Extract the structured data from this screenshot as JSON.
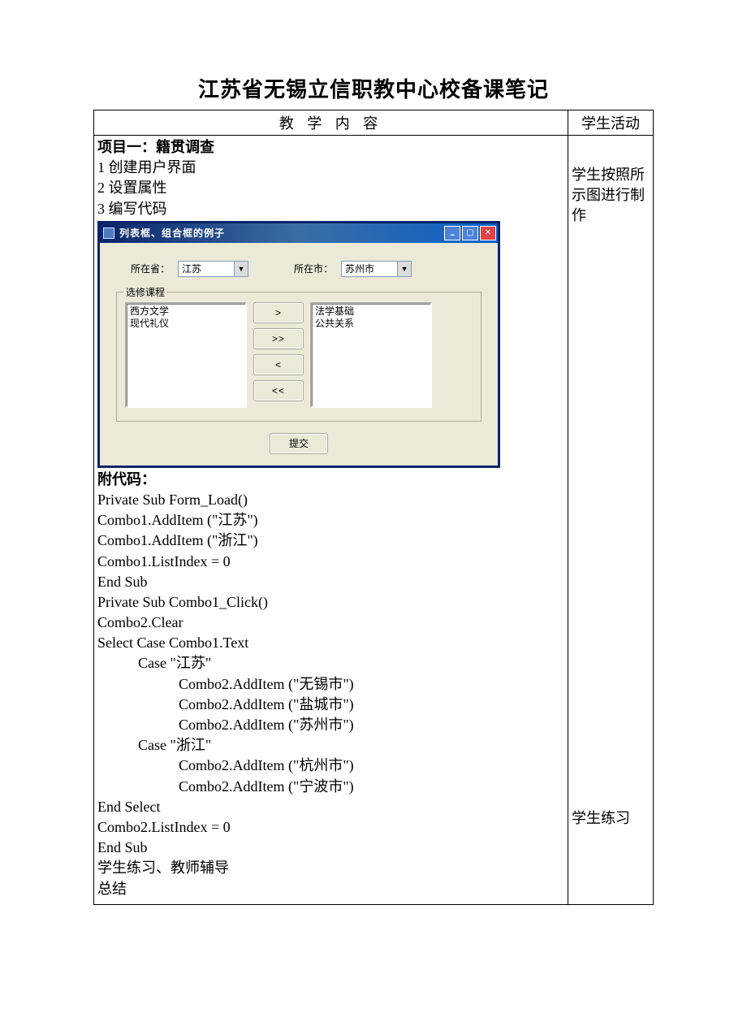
{
  "doc": {
    "title": "江苏省无锡立信职教中心校备课笔记",
    "col_left_header": "教 学 内 容",
    "col_right_header": "学生活动",
    "project_title": "项目一：籍贯调查",
    "steps": [
      "1 创建用户界面",
      "2 设置属性",
      "3 编写代码"
    ],
    "code_label": "附代码：",
    "code_lines": [
      "Private Sub Form_Load()",
      "Combo1.AddItem (\"江苏\")",
      "Combo1.AddItem (\"浙江\")",
      "Combo1.ListIndex = 0",
      "End Sub",
      "Private Sub Combo1_Click()",
      "Combo2.Clear",
      "Select Case Combo1.Text"
    ],
    "case1_label": "Case \"江苏\"",
    "case1_lines": [
      "Combo2.AddItem (\"无锡市\")",
      "Combo2.AddItem (\"盐城市\")",
      "Combo2.AddItem (\"苏州市\")"
    ],
    "case2_label": "Case \"浙江\"",
    "case2_lines": [
      "Combo2.AddItem (\"杭州市\")",
      "Combo2.AddItem (\"宁波市\")"
    ],
    "tail_lines": [
      "End Select",
      "Combo2.ListIndex = 0",
      "End Sub",
      "学生练习、教师辅导",
      "总结"
    ],
    "activity_top": "学生按照所示图进行制作",
    "activity_bottom": "学生练习"
  },
  "win": {
    "title": "列表框、组合框的例子",
    "province_label": "所在省：",
    "city_label": "所在市：",
    "province_value": "江苏",
    "city_value": "苏州市",
    "fieldset_label": "选修课程",
    "left_list": [
      "西方文学",
      "现代礼仪"
    ],
    "right_list": [
      "法学基础",
      "公共关系"
    ],
    "btn_right": ">",
    "btn_all_right": ">>",
    "btn_left": "<",
    "btn_all_left": "<<",
    "submit": "提交"
  }
}
